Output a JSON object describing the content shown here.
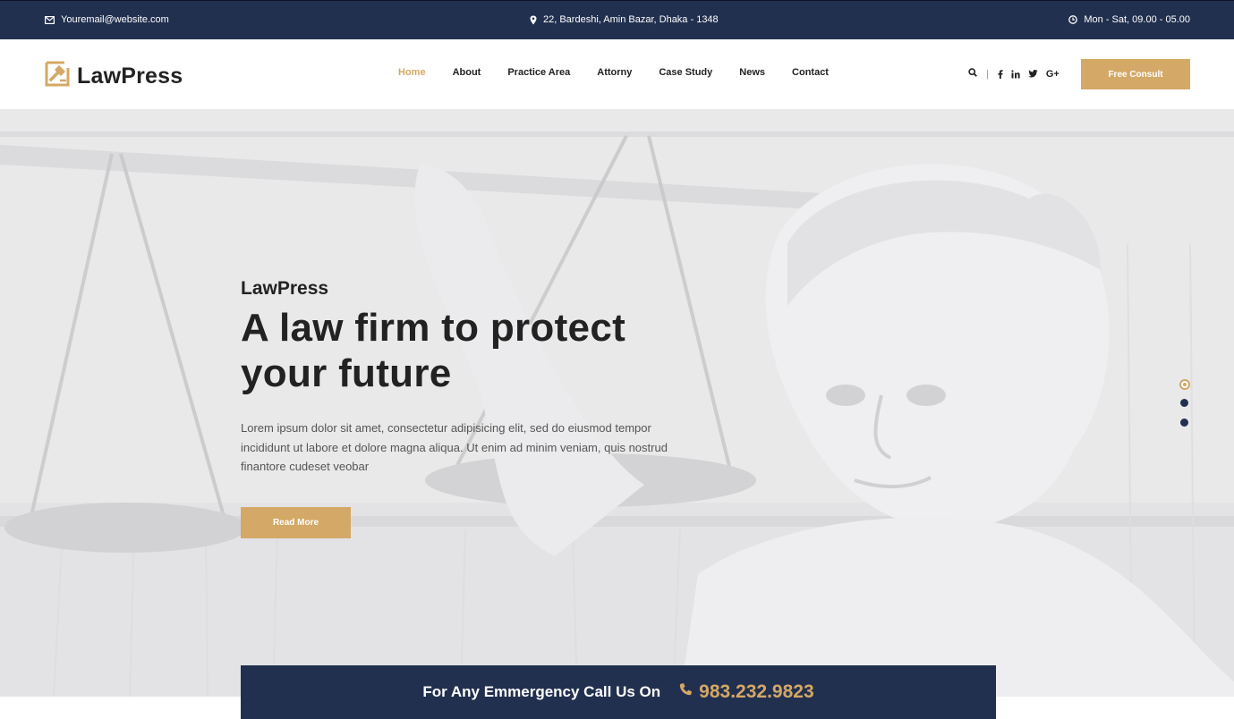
{
  "topbar": {
    "email": "Youremail@website.com",
    "address": "22, Bardeshi, Amin Bazar, Dhaka - 1348",
    "hours": "Mon - Sat, 09.00 - 05.00"
  },
  "header": {
    "logo_text": "LawPress",
    "nav": [
      "Home",
      "About",
      "Practice Area",
      "Attorny",
      "Case Study",
      "News",
      "Contact"
    ],
    "active_nav": "Home",
    "social": [
      "f",
      "in",
      "twitter",
      "G+"
    ],
    "consult_button": "Free Consult"
  },
  "hero": {
    "kicker": "LawPress",
    "title_line1": "A law firm to protect",
    "title_line2": "your future",
    "text": "Lorem ipsum dolor sit amet, consectetur adipisicing elit, sed do eiusmod tempor incididunt ut labore et dolore magna aliqua. Ut enim ad minim veniam, quis nostrud finantore cudeset veobar",
    "button": "Read More",
    "slides": 3,
    "active_slide": 1
  },
  "emergency": {
    "label": "For Any Emmergency Call Us On",
    "phone": "983.232.9823"
  },
  "colors": {
    "navy": "#22304f",
    "gold": "#d4a866",
    "dark_text": "#222222"
  },
  "icons": [
    "envelope-icon",
    "map-pin-icon",
    "clock-icon",
    "search-icon",
    "facebook-icon",
    "linkedin-icon",
    "twitter-icon",
    "google-plus-icon",
    "phone-icon",
    "gavel-logo-icon"
  ]
}
